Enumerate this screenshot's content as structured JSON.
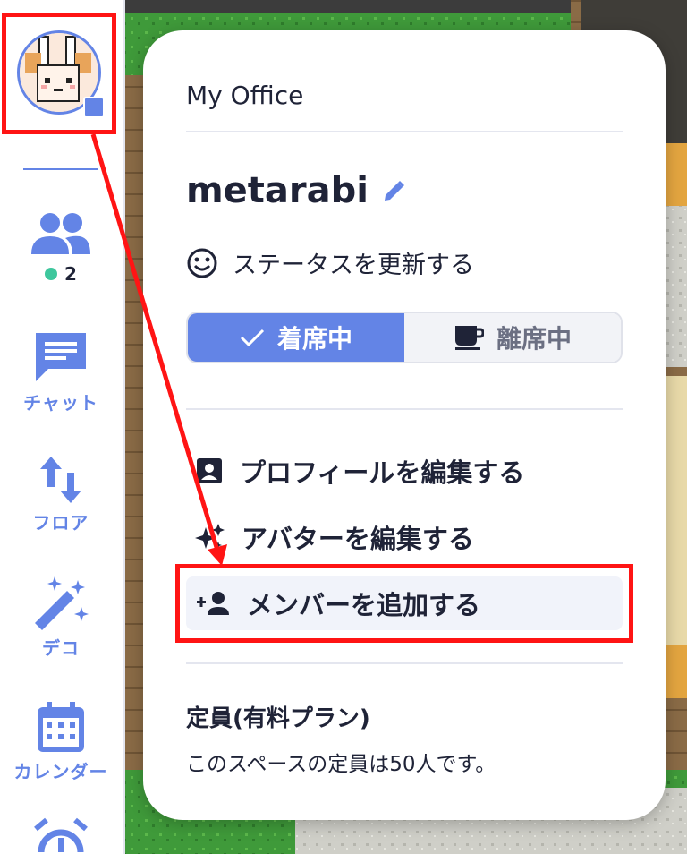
{
  "sidebar": {
    "online_count": "2",
    "nav": [
      {
        "label": "",
        "icon": "people-icon"
      },
      {
        "label": "チャット",
        "icon": "chat-icon"
      },
      {
        "label": "フロア",
        "icon": "floor-arrows-icon"
      },
      {
        "label": "デコ",
        "icon": "magic-wand-icon"
      },
      {
        "label": "カレンダー",
        "icon": "calendar-icon"
      },
      {
        "label": "",
        "icon": "alarm-icon"
      }
    ]
  },
  "menu": {
    "title": "My Office",
    "user_name": "metarabi",
    "status_update": "ステータスを更新する",
    "presence": {
      "available": "着席中",
      "away": "離席中",
      "selected": "available"
    },
    "items": [
      {
        "label": "プロフィールを編集する",
        "icon": "profile-card-icon"
      },
      {
        "label": "アバターを編集する",
        "icon": "sparkle-icon"
      },
      {
        "label": "メンバーを追加する",
        "icon": "add-person-icon"
      }
    ],
    "plan_title": "定員(有料プラン)",
    "plan_desc": "このスペースの定員は50人です。"
  },
  "colors": {
    "accent": "#6384e6",
    "annotation": "#ff1414",
    "online": "#3ec79d",
    "text": "#1f2337"
  }
}
